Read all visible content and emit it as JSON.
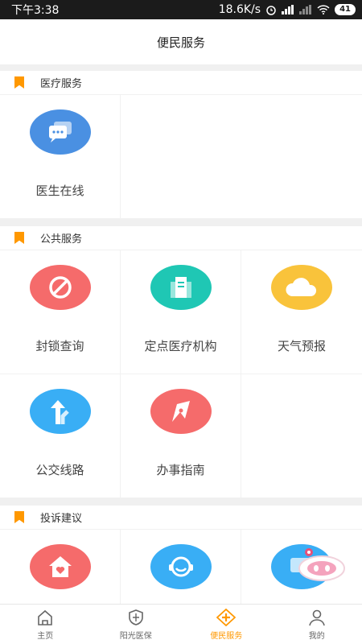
{
  "status": {
    "time": "下午3:38",
    "speed": "18.6K/s",
    "battery": "41"
  },
  "header": {
    "title": "便民服务"
  },
  "sections": [
    {
      "title": "医疗服务",
      "items": [
        {
          "label": "医生在线",
          "icon": "chat-bubble-icon",
          "color": "#4a90e2"
        }
      ]
    },
    {
      "title": "公共服务",
      "items": [
        {
          "label": "封锁查询",
          "icon": "block-icon",
          "color": "#f56b6b"
        },
        {
          "label": "定点医疗机构",
          "icon": "building-icon",
          "color": "#1fc7b4"
        },
        {
          "label": "天气预报",
          "icon": "cloud-icon",
          "color": "#f9c33b"
        },
        {
          "label": "公交线路",
          "icon": "route-arrow-icon",
          "color": "#39aef5"
        },
        {
          "label": "办事指南",
          "icon": "compass-icon",
          "color": "#f56b6b"
        }
      ]
    },
    {
      "title": "投诉建议",
      "items": [
        {
          "label": "",
          "icon": "house-heart-icon",
          "color": "#f56b6b"
        },
        {
          "label": "",
          "icon": "service-smile-icon",
          "color": "#39aef5"
        },
        {
          "label": "",
          "icon": "chat-icon",
          "color": "#39aef5"
        }
      ]
    }
  ],
  "tabs": [
    {
      "label": "主页",
      "icon": "home-icon"
    },
    {
      "label": "阳光医保",
      "icon": "shield-icon"
    },
    {
      "label": "便民服务",
      "icon": "plus-diamond-icon"
    },
    {
      "label": "我的",
      "icon": "user-icon"
    }
  ],
  "colors": {
    "accent": "#ff9800"
  }
}
